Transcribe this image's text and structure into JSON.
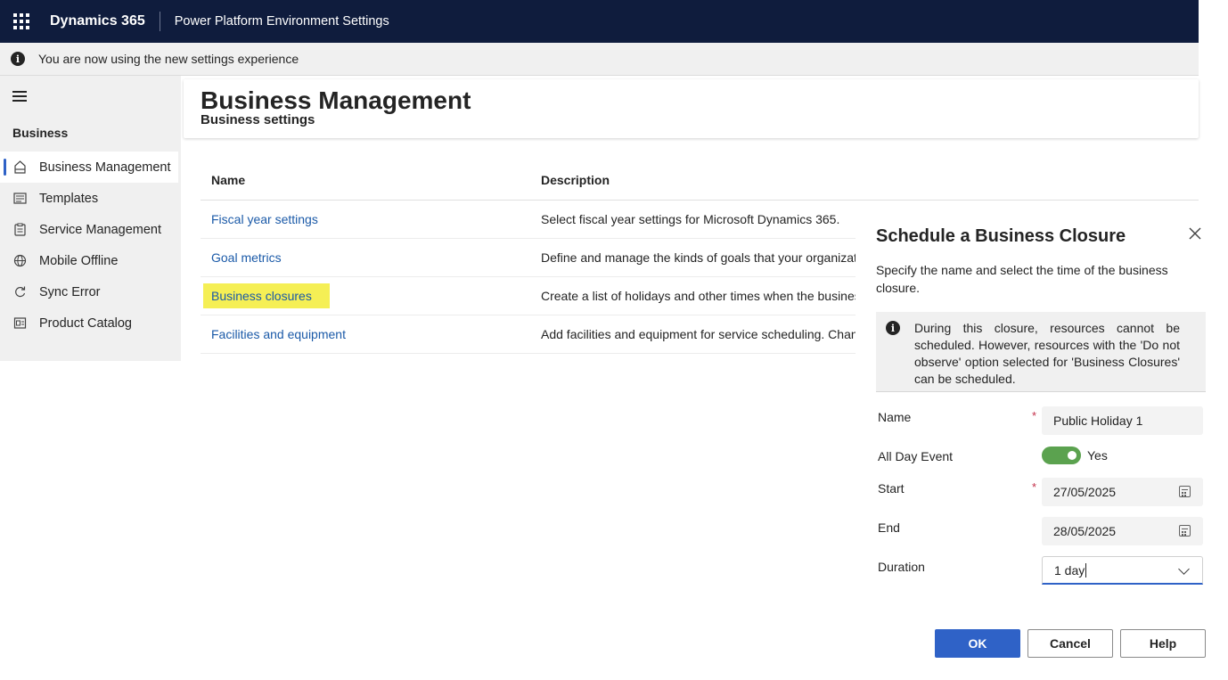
{
  "topbar": {
    "brand": "Dynamics 365",
    "app_title": "Power Platform Environment Settings",
    "bg_color": "#0f1c3d"
  },
  "notice": {
    "text": "You are now using the new settings experience",
    "icon": "info-icon"
  },
  "sidebar": {
    "section_title": "Business",
    "items": [
      {
        "label": "Business Management",
        "icon": "business-management-icon",
        "active": true
      },
      {
        "label": "Templates",
        "icon": "templates-icon",
        "active": false
      },
      {
        "label": "Service Management",
        "icon": "service-management-icon",
        "active": false
      },
      {
        "label": "Mobile Offline",
        "icon": "globe-icon",
        "active": false
      },
      {
        "label": "Sync Error",
        "icon": "sync-error-icon",
        "active": false
      },
      {
        "label": "Product Catalog",
        "icon": "product-catalog-icon",
        "active": false
      }
    ]
  },
  "page": {
    "title": "Business Management",
    "subtitle": "Business settings"
  },
  "table": {
    "headers": [
      "Name",
      "Description"
    ],
    "rows": [
      {
        "name": "Fiscal year settings",
        "description": "Select fiscal year settings for Microsoft Dynamics 365."
      },
      {
        "name": "Goal metrics",
        "description": "Define and manage the kinds of goals that your organizat"
      },
      {
        "name": "Business closures",
        "description": "Create a list of holidays and other times when the busines",
        "highlighted": true
      },
      {
        "name": "Facilities and equipment",
        "description": "Add facilities and equipment for service scheduling. Chan"
      }
    ]
  },
  "dialog": {
    "title": "Schedule a Business Closure",
    "description": "Specify the name and select the time of the business closure.",
    "info": "During this closure, resources cannot be scheduled. However, resources with the 'Do not observe' option selected for 'Business Closures' can be scheduled.",
    "fields": {
      "name_label": "Name",
      "name_value": "Public Holiday 1",
      "all_day_label": "All Day Event",
      "all_day_value": "Yes",
      "start_label": "Start",
      "start_value": "27/05/2025",
      "end_label": "End",
      "end_value": "28/05/2025",
      "duration_label": "Duration",
      "duration_value": "1 day"
    },
    "required_mark": "*",
    "buttons": {
      "ok": "OK",
      "cancel": "Cancel",
      "help": "Help"
    },
    "accent_color": "#2f62c7",
    "toggle_color": "#5ba24f"
  }
}
